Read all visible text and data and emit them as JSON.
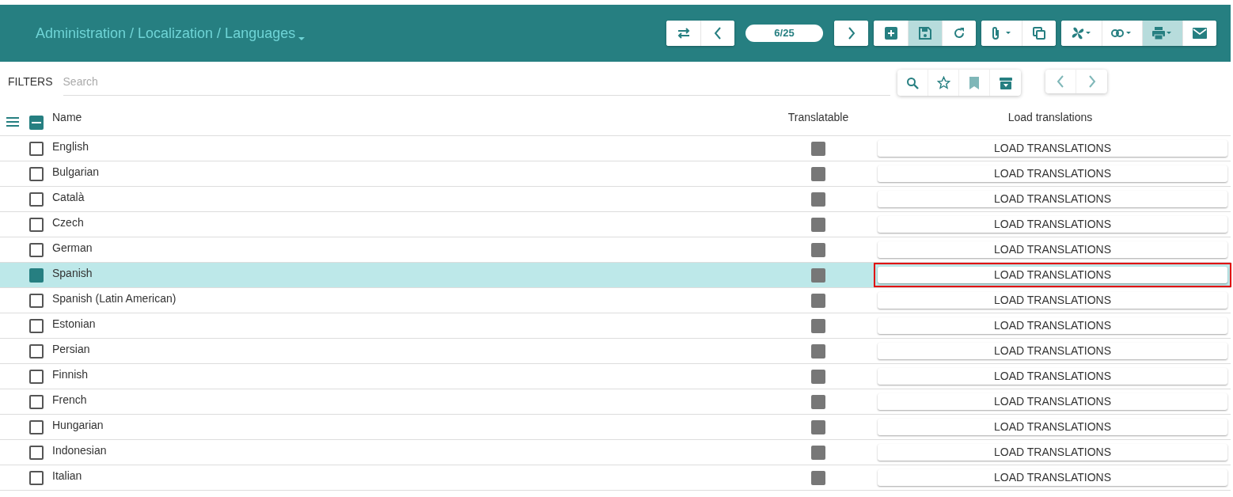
{
  "breadcrumb": "Administration / Localization / Languages",
  "pager": "6/25",
  "toolbar": [
    [
      {
        "kind": "swap",
        "active": false
      },
      {
        "kind": "prev",
        "active": false
      }
    ],
    [
      {
        "kind": "pager"
      }
    ],
    [
      {
        "kind": "next",
        "active": false
      }
    ],
    [
      {
        "kind": "add",
        "active": false
      },
      {
        "kind": "save",
        "active": true
      },
      {
        "kind": "refresh",
        "active": false
      }
    ],
    [
      {
        "kind": "attach",
        "active": false
      },
      {
        "kind": "copy",
        "active": false
      }
    ],
    [
      {
        "kind": "fan",
        "active": false
      },
      {
        "kind": "link",
        "active": false
      },
      {
        "kind": "print",
        "active": true
      },
      {
        "kind": "mail",
        "active": false
      }
    ]
  ],
  "filters": {
    "label": "FILTERS",
    "placeholder": "Search"
  },
  "table": {
    "columns": [
      "Name",
      "Translatable",
      "Load translations"
    ],
    "select_all_indeterminate": true,
    "rows": [
      {
        "name": "English",
        "selected": false,
        "translatable": true,
        "button": "LOAD TRANSLATIONS",
        "highlighted": false
      },
      {
        "name": "Bulgarian",
        "selected": false,
        "translatable": true,
        "button": "LOAD TRANSLATIONS",
        "highlighted": false
      },
      {
        "name": "Català",
        "selected": false,
        "translatable": true,
        "button": "LOAD TRANSLATIONS",
        "highlighted": false
      },
      {
        "name": "Czech",
        "selected": false,
        "translatable": true,
        "button": "LOAD TRANSLATIONS",
        "highlighted": false
      },
      {
        "name": "German",
        "selected": false,
        "translatable": true,
        "button": "LOAD TRANSLATIONS",
        "highlighted": false
      },
      {
        "name": "Spanish",
        "selected": true,
        "translatable": true,
        "button": "LOAD TRANSLATIONS",
        "highlighted": true
      },
      {
        "name": "Spanish (Latin American)",
        "selected": false,
        "translatable": true,
        "button": "LOAD TRANSLATIONS",
        "highlighted": false
      },
      {
        "name": "Estonian",
        "selected": false,
        "translatable": true,
        "button": "LOAD TRANSLATIONS",
        "highlighted": false
      },
      {
        "name": "Persian",
        "selected": false,
        "translatable": true,
        "button": "LOAD TRANSLATIONS",
        "highlighted": false
      },
      {
        "name": "Finnish",
        "selected": false,
        "translatable": true,
        "button": "LOAD TRANSLATIONS",
        "highlighted": false
      },
      {
        "name": "French",
        "selected": false,
        "translatable": true,
        "button": "LOAD TRANSLATIONS",
        "highlighted": false
      },
      {
        "name": "Hungarian",
        "selected": false,
        "translatable": true,
        "button": "LOAD TRANSLATIONS",
        "highlighted": false
      },
      {
        "name": "Indonesian",
        "selected": false,
        "translatable": true,
        "button": "LOAD TRANSLATIONS",
        "highlighted": false
      },
      {
        "name": "Italian",
        "selected": false,
        "translatable": true,
        "button": "LOAD TRANSLATIONS",
        "highlighted": false
      }
    ]
  }
}
